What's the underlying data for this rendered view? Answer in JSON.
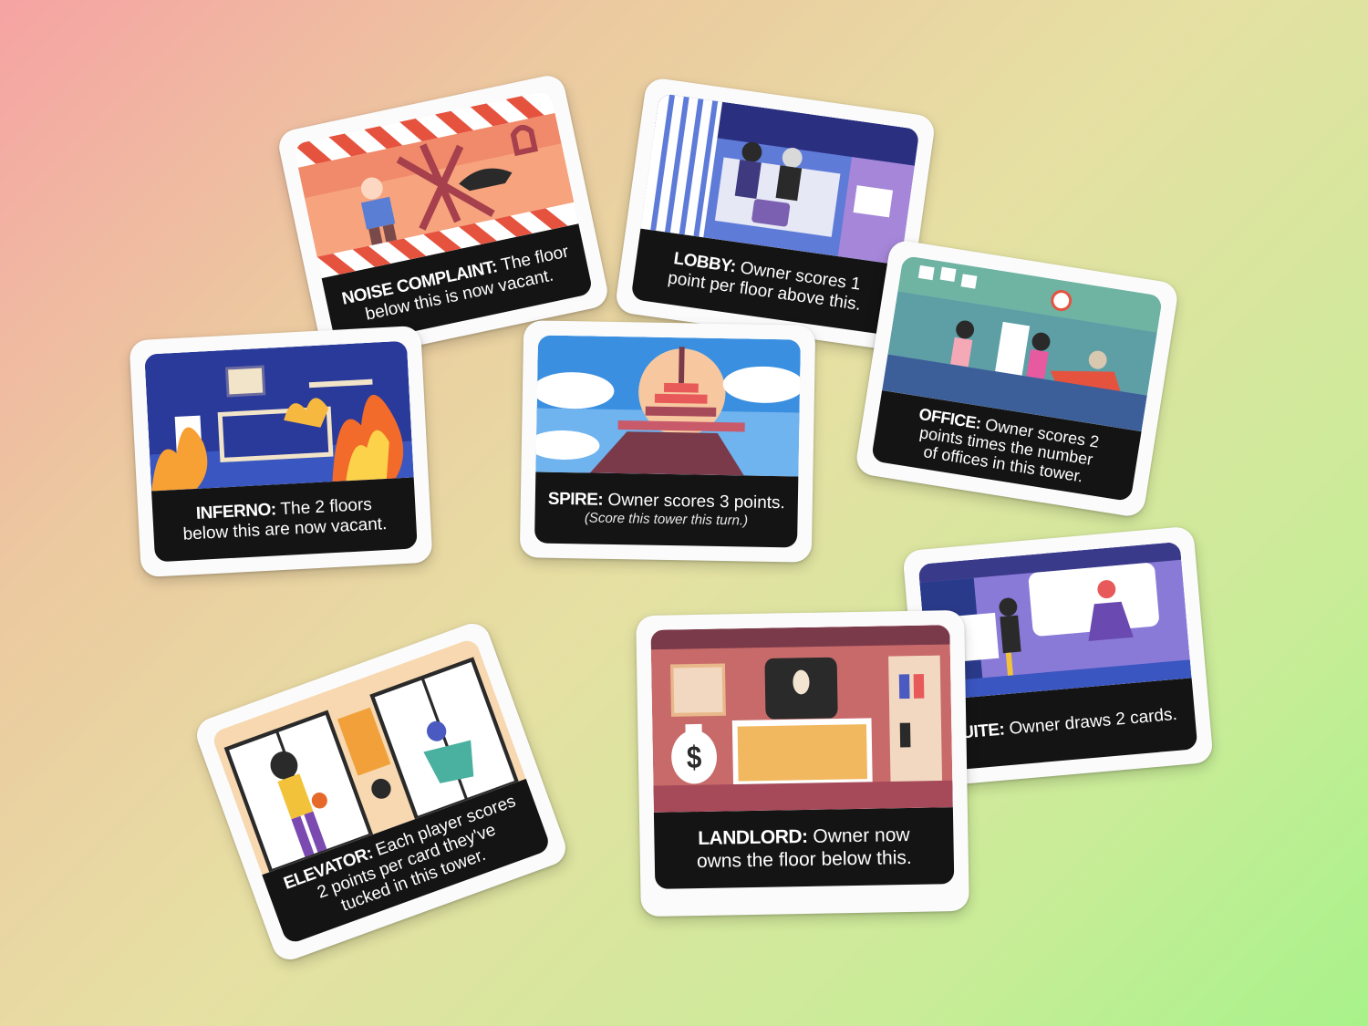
{
  "cards": {
    "noise": {
      "name": "NOISE COMPLAINT:",
      "line1": "The floor",
      "line2": "below this is now vacant."
    },
    "lobby": {
      "name": "LOBBY:",
      "line1": "Owner scores 1",
      "line2": "point per floor above this."
    },
    "office": {
      "name": "OFFICE:",
      "line1": "Owner scores 2",
      "line2": "points times the number",
      "line3": "of offices in this tower."
    },
    "inferno": {
      "name": "INFERNO:",
      "line1": "The 2 floors",
      "line2": "below this are now vacant."
    },
    "spire": {
      "name": "SPIRE:",
      "line1": "Owner scores 3 points.",
      "note": "(Score this tower this turn.)"
    },
    "elevator": {
      "name": "ELEVATOR:",
      "line1": "Each player scores",
      "line2": "2 points per card they've",
      "line3": "tucked in this tower."
    },
    "landlord": {
      "name": "LANDLORD:",
      "line1": "Owner now",
      "line2": "owns the floor below this."
    },
    "suite": {
      "name": "SUITE:",
      "line1": "Owner draws 2 cards."
    }
  },
  "colors": {
    "panel": "#141414",
    "card": "#fbfbfb"
  }
}
